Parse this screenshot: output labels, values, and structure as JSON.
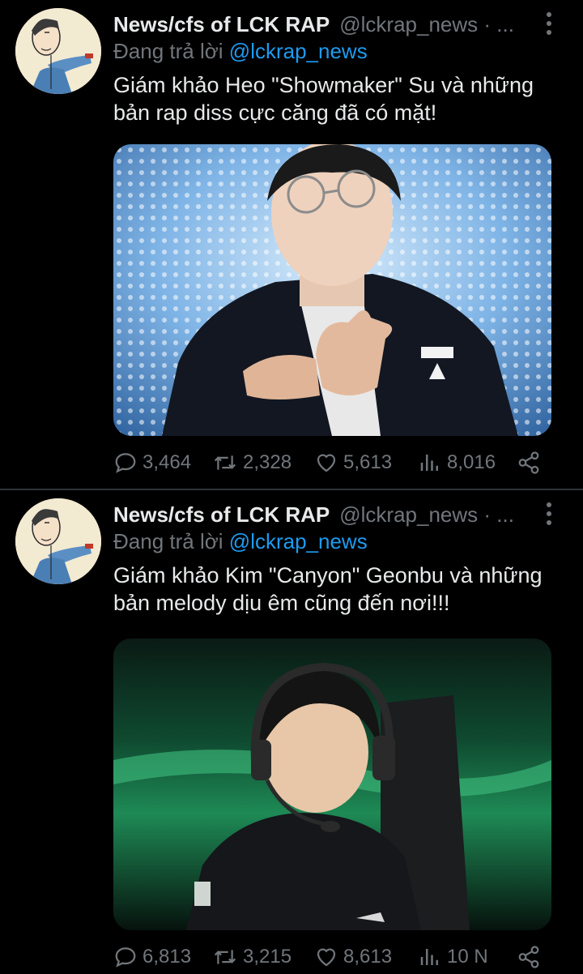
{
  "tweets": [
    {
      "display_name": "News/cfs of LCK RAP",
      "handle": "@lckrap_news · ...",
      "reply_prefix": "Đang trả lời",
      "reply_to": "@lckrap_news",
      "text": "Giám khảo Heo \"Showmaker\" Su và những bản rap diss cực căng đã có mặt!",
      "replies": "3,464",
      "retweets": "2,328",
      "likes": "5,613",
      "views": "8,016"
    },
    {
      "display_name": "News/cfs of LCK RAP",
      "handle": "@lckrap_news · ...",
      "reply_prefix": "Đang trả lời",
      "reply_to": "@lckrap_news",
      "text": "Giám khảo Kim \"Canyon\" Geonbu và những bản melody dịu êm cũng đến nơi!!!",
      "replies": "6,813",
      "retweets": "3,215",
      "likes": "8,613",
      "views": "10 N"
    }
  ],
  "colors": {
    "background": "#000000",
    "text": "#e7e9ea",
    "muted": "#71767b",
    "link": "#1d9bf0",
    "divider": "#2f3336"
  },
  "icons": [
    "avatar-cartoon",
    "more-vertical-icon",
    "reply-icon",
    "retweet-icon",
    "like-icon",
    "views-icon",
    "share-icon"
  ]
}
